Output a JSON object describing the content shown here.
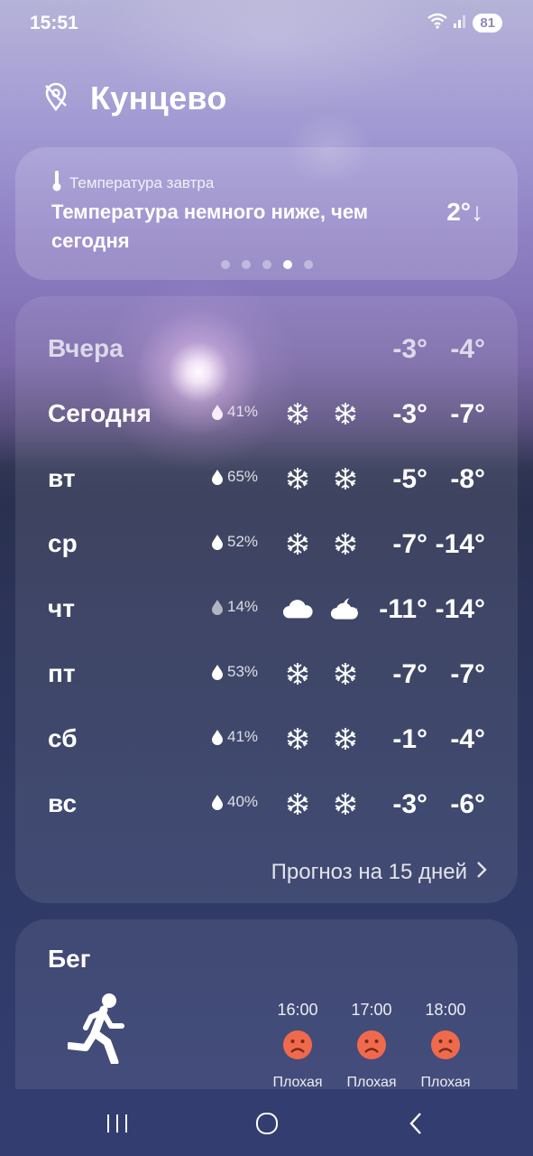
{
  "status": {
    "time": "15:51",
    "battery": "81"
  },
  "location": {
    "name": "Кунцево"
  },
  "alert": {
    "label": "Температура завтра",
    "text": "Температура немного ниже, чем сегодня",
    "value": "2°↓"
  },
  "forecast": {
    "rows": [
      {
        "day": "Вчера",
        "precip": "",
        "max": "-3°",
        "min": "-4°"
      },
      {
        "day": "Сегодня",
        "precip": "41%",
        "max": "-3°",
        "min": "-7°"
      },
      {
        "day": "вт",
        "precip": "65%",
        "max": "-5°",
        "min": "-8°"
      },
      {
        "day": "ср",
        "precip": "52%",
        "max": "-7°",
        "min": "-14°"
      },
      {
        "day": "чт",
        "precip": "14%",
        "max": "-11°",
        "min": "-14°"
      },
      {
        "day": "пт",
        "precip": "53%",
        "max": "-7°",
        "min": "-7°"
      },
      {
        "day": "сб",
        "precip": "41%",
        "max": "-1°",
        "min": "-4°"
      },
      {
        "day": "вс",
        "precip": "40%",
        "max": "-3°",
        "min": "-6°"
      }
    ],
    "more_label": "Прогноз на 15 дней"
  },
  "running": {
    "title": "Бег",
    "slots": [
      {
        "time": "16:00",
        "condition": "Плохая"
      },
      {
        "time": "17:00",
        "condition": "Плохая"
      },
      {
        "time": "18:00",
        "condition": "Плохая"
      }
    ]
  },
  "colors": {
    "sad_face": "#ef6a4c"
  }
}
